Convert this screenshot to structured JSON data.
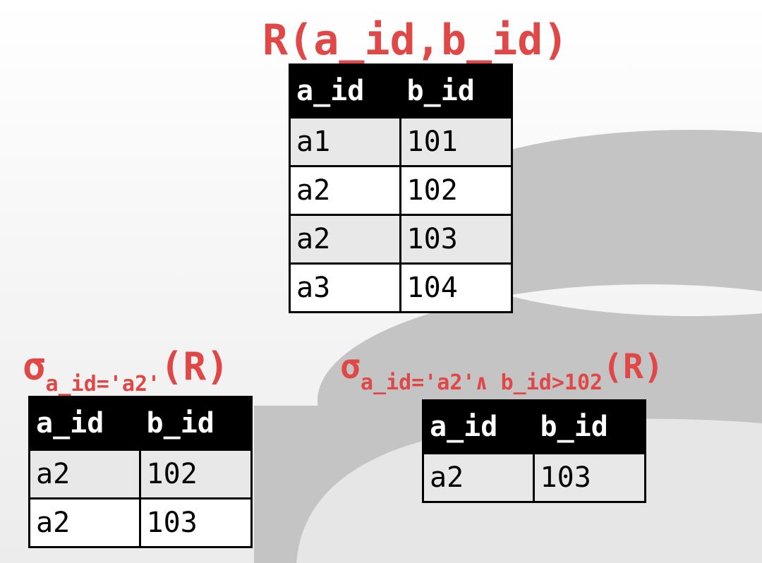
{
  "relation_r": {
    "title": "R(a_id,b_id)",
    "headers": [
      "a_id",
      "b_id"
    ],
    "rows": [
      [
        "a1",
        "101"
      ],
      [
        "a2",
        "102"
      ],
      [
        "a2",
        "103"
      ],
      [
        "a3",
        "104"
      ]
    ]
  },
  "select_one": {
    "sigma": "σ",
    "predicate": "a_id='a2'",
    "operand": "(R)",
    "headers": [
      "a_id",
      "b_id"
    ],
    "rows": [
      [
        "a2",
        "102"
      ],
      [
        "a2",
        "103"
      ]
    ]
  },
  "select_two": {
    "sigma": "σ",
    "predicate": "a_id='a2'∧ b_id>102",
    "operand": "(R)",
    "headers": [
      "a_id",
      "b_id"
    ],
    "rows": [
      [
        "a2",
        "103"
      ]
    ]
  },
  "colors": {
    "accent": "#e04848",
    "header_bg": "#000000",
    "row_alt": "#e8e8e8",
    "logo": "#c4c4c4"
  },
  "background_logo": {
    "icon": "database-cylinder-icon"
  }
}
